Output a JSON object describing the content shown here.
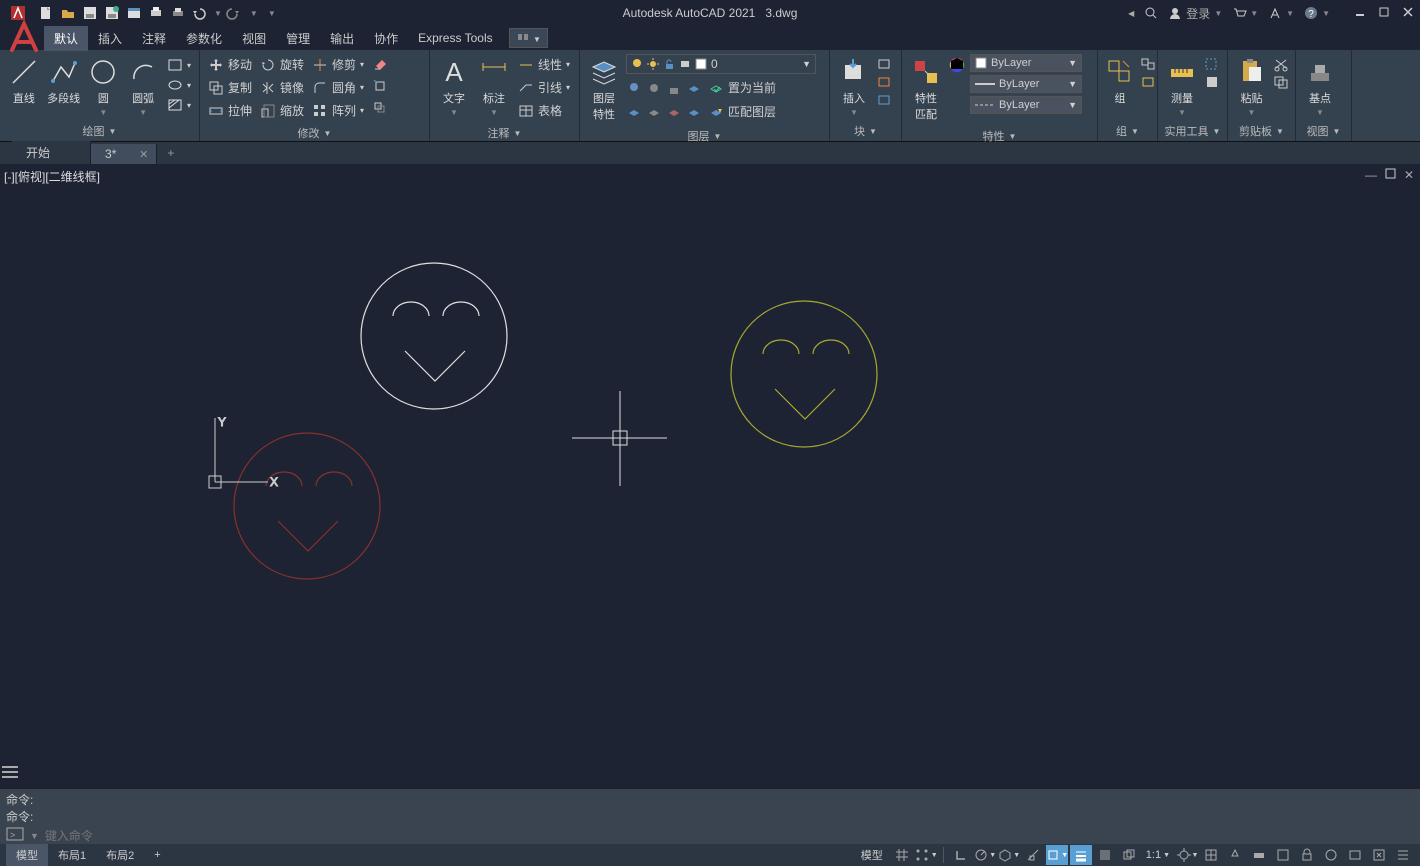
{
  "title": {
    "app": "Autodesk AutoCAD 2021",
    "file": "3.dwg"
  },
  "qat": [
    "new",
    "open",
    "save",
    "saveas",
    "plot-preview",
    "plot",
    "print",
    "undo",
    "redo"
  ],
  "topright": {
    "login": "登录"
  },
  "menu": {
    "items": [
      "默认",
      "插入",
      "注释",
      "参数化",
      "视图",
      "管理",
      "输出",
      "协作",
      "Express Tools"
    ],
    "active": 0
  },
  "ribbon": {
    "draw": {
      "title": "绘图",
      "line": "直线",
      "polyline": "多段线",
      "circle": "圆",
      "arc": "圆弧"
    },
    "modify": {
      "title": "修改",
      "move": "移动",
      "rotate": "旋转",
      "trim": "修剪",
      "copy": "复制",
      "mirror": "镜像",
      "fillet": "圆角",
      "stretch": "拉伸",
      "scale": "缩放",
      "array": "阵列"
    },
    "annot": {
      "title": "注释",
      "text": "文字",
      "dim": "标注",
      "linear": "线性",
      "leader": "引线",
      "table": "表格"
    },
    "layer": {
      "title": "图层",
      "props": "图层\n特性",
      "current": "0",
      "setcurrent": "置为当前",
      "match": "匹配图层"
    },
    "block": {
      "title": "块",
      "insert": "插入"
    },
    "props": {
      "title": "特性",
      "match": "特性\n匹配",
      "bylayer": "ByLayer"
    },
    "group": {
      "title": "组",
      "grp": "组"
    },
    "util": {
      "title": "实用工具",
      "measure": "测量"
    },
    "clip": {
      "title": "剪贴板",
      "paste": "粘贴"
    },
    "view": {
      "title": "视图",
      "base": "基点"
    }
  },
  "filetabs": {
    "tabs": [
      {
        "label": "开始"
      },
      {
        "label": "3*",
        "active": true
      }
    ]
  },
  "viewport": {
    "label": "[-][俯视][二维线框]"
  },
  "ucs": {
    "x": "X",
    "y": "Y"
  },
  "cmd": {
    "hist1": "命令:",
    "hist2": "命令:",
    "placeholder": "键入命令"
  },
  "layouttabs": {
    "tabs": [
      "模型",
      "布局1",
      "布局2"
    ]
  },
  "status": {
    "model": "模型",
    "scale": "1:1"
  }
}
